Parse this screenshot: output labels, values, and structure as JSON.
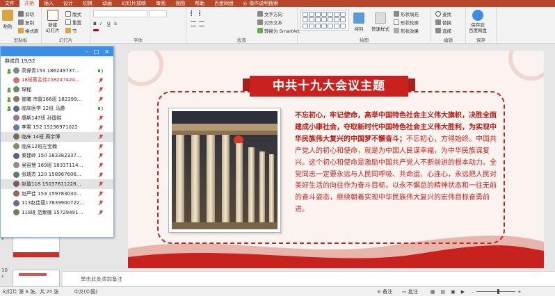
{
  "menubar": {
    "items": [
      "文件",
      "开始",
      "插入",
      "设计",
      "切换",
      "动画",
      "幻灯片放映",
      "审阅",
      "视图",
      "帮助",
      "百度网盘"
    ],
    "active_index": 1,
    "search_label": "操作说明搜索"
  },
  "ribbon": {
    "clipboard": {
      "paste": "粘贴",
      "cut": "剪切",
      "copy": "复制",
      "format_painter": "格式刷",
      "label": "剪贴板"
    },
    "slides": {
      "new_slide": "新建\n幻灯片",
      "layout": "版式",
      "reset": "重置",
      "section": "节",
      "label": "幻灯片"
    },
    "font": {
      "label": "字体"
    },
    "paragraph": {
      "text_direction": "文字方向",
      "align_text": "对齐文本",
      "smartart": "转换为 SmartArt",
      "label": "段落"
    },
    "drawing": {
      "arrange": "排列",
      "quick_styles": "快速样式",
      "shape_fill": "形状填充",
      "shape_outline": "形状轮廓",
      "shape_effects": "形状效果",
      "label": "绘图"
    },
    "editing": {
      "find": "查找",
      "replace": "替换",
      "select": "选择",
      "label": "编辑"
    },
    "save": {
      "save_to": "保存到\n百度网盘",
      "label": "保存"
    }
  },
  "thumbnails": [
    {
      "number": "9",
      "star": "*"
    },
    {
      "number": "10",
      "star": "*"
    }
  ],
  "chat": {
    "count": "群成员 19/32",
    "members": [
      {
        "name": "高保青153  18624973​7…",
        "color": "normal",
        "mic": true,
        "status": "speak"
      },
      {
        "name": "18班蔡孟伟158247424…",
        "color": "red",
        "mic": false,
        "status": "muted"
      },
      {
        "name": "琛程",
        "color": "normal",
        "mic": true,
        "status": "muted"
      },
      {
        "name": "崔曦 市雷166班 182399…",
        "color": "normal",
        "mic": true,
        "status": "muted"
      },
      {
        "name": "临床医学 12班 马爵",
        "color": "normal",
        "mic": true,
        "status": "speak"
      },
      {
        "name": "康斯147班 孙国胜",
        "color": "normal",
        "mic": false,
        "status": "muted"
      },
      {
        "name": "李君 152 15236971022",
        "color": "normal",
        "mic": false,
        "status": "muted"
      },
      {
        "name": "临床 14班 周宇博",
        "color": "normal",
        "mic": false,
        "status": "muted",
        "selected": true
      },
      {
        "name": "临床12班左宝楠",
        "color": "normal",
        "mic": false,
        "status": "muted"
      },
      {
        "name": "秦建岭 150 183382337…",
        "color": "normal",
        "mic": false,
        "status": "muted"
      },
      {
        "name": "吴容慧 169班 18337114…",
        "color": "normal",
        "mic": false,
        "status": "muted"
      },
      {
        "name": "张瑞杰 120 158967606…",
        "color": "normal",
        "mic": false,
        "status": "muted"
      },
      {
        "name": "赵璇118   15037611228…",
        "color": "normal",
        "mic": false,
        "status": "muted",
        "selected": true
      },
      {
        "name": "赵严佳 153 159783030…",
        "color": "normal",
        "mic": false,
        "status": "muted"
      },
      {
        "name": "113赵佳丽17839900722…",
        "color": "normal",
        "mic": false,
        "status": "muted"
      },
      {
        "name": "118班 范紫微 15729491…",
        "color": "normal",
        "mic": false,
        "status": "muted"
      }
    ]
  },
  "slide": {
    "title": "中共十九大会议主题",
    "bold_text": "不忘初心，牢记使命，高举中国特色社会主义伟大旗帜，决胜全面建成小康社会，夺取新时代中国特色社会主义伟大胜利，为实现中华民族伟大复兴的中国梦不懈奋斗；",
    "body_text": "不忘初心，方得始终。中国共产党人的初心和使命，就是为中国人民谋幸福，为中华民族谋复兴。这个初心和使命是激励中国共产党人不断前进的根本动力。全党同志一定要永远与人民同呼吸、共命运、心连心，永远把人民对美好生活的向往作为奋斗目标，以永不懈怠的精神状态和一往无前的奋斗姿态，继续朝着实现中华民族伟大复兴的宏伟目标奋勇前进。"
  },
  "notes": {
    "placeholder": "单击此处添加备注"
  },
  "status": {
    "slide_info": "幻灯片 第 6 张，共 25 张",
    "language": "中文(中国)",
    "notes_btn": "备注",
    "comments_btn": "批注"
  },
  "colors": {
    "accent": "#b7472a",
    "slide_red": "#c9211e",
    "chat_blue": "#3c8ee5"
  }
}
